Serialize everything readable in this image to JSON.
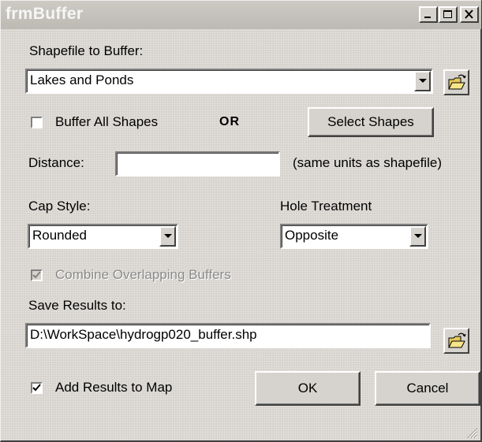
{
  "window": {
    "title": "frmBuffer"
  },
  "shapefile": {
    "label": "Shapefile to Buffer:",
    "value": "Lakes and Ponds"
  },
  "buffer_all": {
    "label": "Buffer All Shapes",
    "checked": false
  },
  "or_label": "OR",
  "select_shapes_label": "Select Shapes",
  "distance": {
    "label": "Distance:",
    "value": "",
    "hint": "(same units as shapefile)"
  },
  "cap_style": {
    "label": "Cap Style:",
    "value": "Rounded"
  },
  "hole_treatment": {
    "label": "Hole Treatment",
    "value": "Opposite"
  },
  "combine": {
    "label": "Combine Overlapping Buffers",
    "checked": true,
    "enabled": false
  },
  "save": {
    "label": "Save Results to:",
    "value": "D:\\WorkSpace\\hydrogp020_buffer.shp"
  },
  "add_to_map": {
    "label": "Add Results to Map",
    "checked": true
  },
  "ok_label": "OK",
  "cancel_label": "Cancel",
  "icons": {
    "minimize": "minimize-icon",
    "maximize": "maximize-icon",
    "close": "close-icon",
    "open_folder": "open-folder-icon",
    "dropdown": "chevron-down-icon",
    "checkmark": "checkmark-icon",
    "resize_grip": "resize-grip-icon"
  }
}
